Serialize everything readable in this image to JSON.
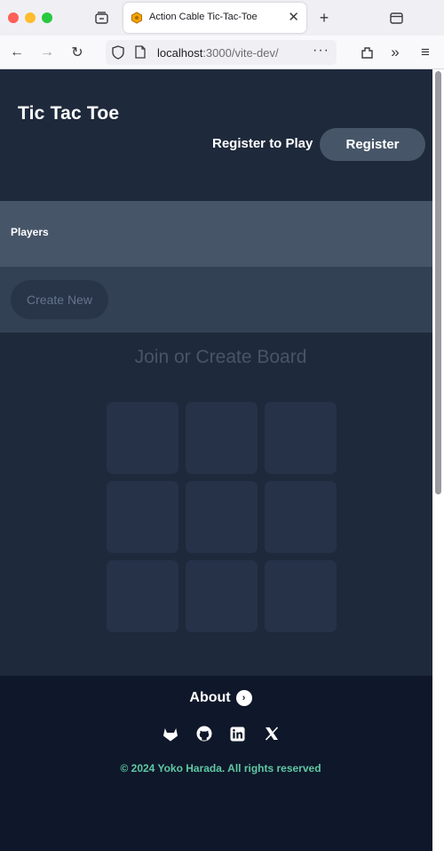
{
  "browser": {
    "tab_title": "Action Cable Tic-Tac-Toe",
    "url_host": "localhost",
    "url_rest": ":3000/vite-dev/"
  },
  "header": {
    "title": "Tic Tac Toe",
    "register_prompt": "Register to Play",
    "register_button": "Register"
  },
  "players": {
    "label": "Players"
  },
  "create": {
    "button_label": "Create New"
  },
  "board": {
    "heading": "Join or Create Board",
    "cells": [
      "",
      "",
      "",
      "",
      "",
      "",
      "",
      "",
      ""
    ]
  },
  "footer": {
    "about_label": "About",
    "social_icons": [
      "gitlab-icon",
      "github-icon",
      "linkedin-icon",
      "x-icon"
    ],
    "copyright": "© 2024 Yoko Harada. All rights reserved"
  },
  "colors": {
    "header_bg": "#1e293b",
    "players_bg": "#475569",
    "create_bg": "#334155",
    "footer_bg": "#0f172a",
    "copyright_color": "#6ee7b7"
  }
}
